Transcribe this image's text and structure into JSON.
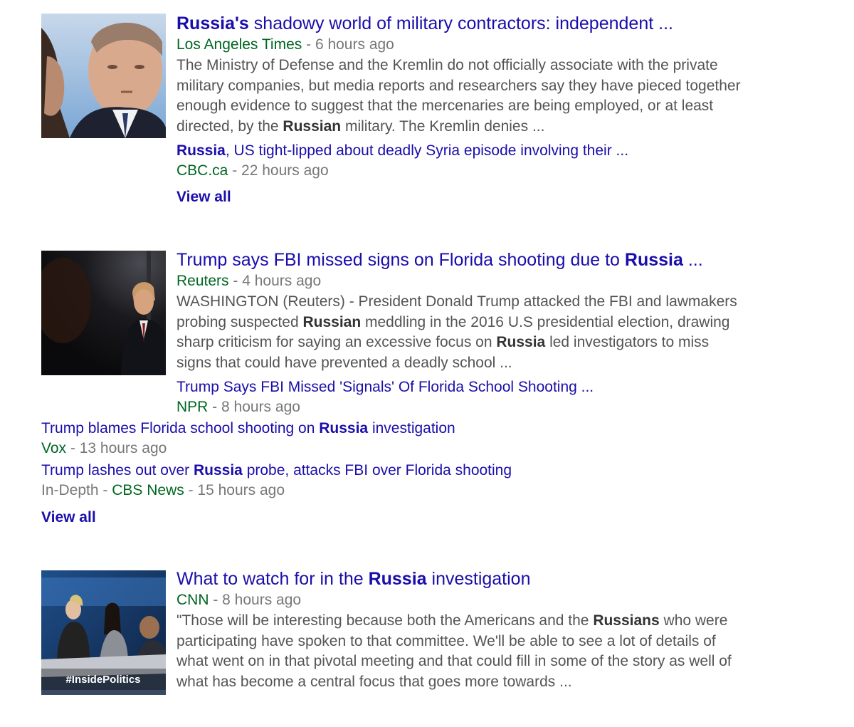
{
  "results": [
    {
      "title_bold": "Russia's",
      "title_rest": " shadowy world of military contractors: independent ...",
      "source": "Los Angeles Times",
      "time": "6 hours ago",
      "snippet": {
        "l1": "The Ministry of Defense and the Kremlin do not officially associate with the private",
        "l2": "military companies, but media reports and researchers say they have pieced together",
        "l3": "enough evidence to suggest that the mercenaries are being employed, or at least",
        "l4_a": "directed, by the ",
        "l4_b": "Russian",
        "l4_c": " military. The Kremlin denies ..."
      },
      "related": [
        {
          "t_a": "Russia",
          "t_b": ", US tight-lipped about deadly Syria episode involving their ...",
          "source": "CBC.ca",
          "time": "22 hours ago"
        }
      ],
      "view_all": "View all"
    },
    {
      "title_a": "Trump says FBI missed signs on Florida shooting due to ",
      "title_bold": "Russia",
      "title_c": " ...",
      "source": "Reuters",
      "time": "4 hours ago",
      "snippet": {
        "l1": "WASHINGTON (Reuters) - President Donald Trump attacked the FBI and lawmakers",
        "l2_a": "probing suspected ",
        "l2_b": "Russian",
        "l2_c": " meddling in the 2016 U.S presidential election, drawing",
        "l3_a": "sharp criticism for saying an excessive focus on ",
        "l3_b": "Russia",
        "l3_c": " led investigators to miss",
        "l4": "signs that could have prevented a deadly school ..."
      },
      "related": [
        {
          "t_a": "Trump Says FBI Missed 'Signals' Of Florida School Shooting ...",
          "source": "NPR",
          "time": "8 hours ago"
        },
        {
          "t_a": "Trump blames Florida school shooting on ",
          "t_b": "Russia",
          "t_c": " investigation",
          "source": "Vox",
          "time": "13 hours ago"
        },
        {
          "t_a": "Trump lashes out over ",
          "t_b": "Russia",
          "t_c": " probe, attacks FBI over Florida shooting",
          "prefix": "In-Depth",
          "source": "CBS News",
          "time": "15 hours ago"
        }
      ],
      "view_all": "View all"
    },
    {
      "title_a": "What to watch for in the ",
      "title_bold": "Russia",
      "title_c": " investigation",
      "source": "CNN",
      "time": "8 hours ago",
      "thumb_caption": "#InsidePolitics",
      "snippet": {
        "l1_a": "\"Those will be interesting because both the Americans and the ",
        "l1_b": "Russians",
        "l1_c": " who were",
        "l2": "participating have spoken to that committee. We'll be able to see a lot of details of",
        "l3": "what went on in that pivotal meeting and that could fill in some of the story as well of",
        "l4": "what has become a central focus that goes more towards ..."
      }
    }
  ],
  "sep": " - ",
  "colors": {
    "link": "#1a0dab",
    "source": "#006621",
    "meta": "#777777",
    "snippet": "#545454"
  }
}
